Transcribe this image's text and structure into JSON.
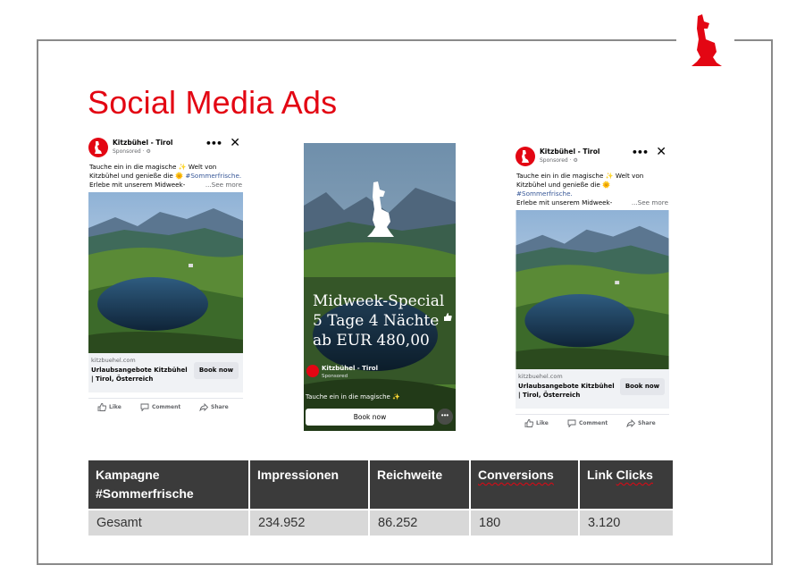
{
  "slide": {
    "title": "Social Media Ads",
    "accent_color": "#e30613",
    "logo_icon": "chamois-logo-icon"
  },
  "ad_feed": {
    "page_name": "Kitzbühel - Tirol",
    "sponsored": "Sponsored · ⚙",
    "text_line1": "Tauche ein in die magische ✨ Welt von",
    "text_line2a": "Kitzbühel und genieße die 🌞 ",
    "text_hashtag": "#Sommerfrische.",
    "text_line3": "Erlebe mit unserem Midweek-",
    "see_more": "...See more",
    "domain": "kitzbuehel.com",
    "headline": "Urlaubsangebote Kitzbühel | Tirol, Österreich",
    "cta": "Book now",
    "like": "Like",
    "comment": "Comment",
    "share": "Share",
    "more_icon": "more-dots-icon",
    "close_icon": "close-icon"
  },
  "ad_story": {
    "headline_line1": "Midweek-Special",
    "headline_line2": "5 Tage 4 Nächte",
    "headline_line3": "ab EUR 480,00",
    "page_name": "Kitzbühel - Tirol",
    "sponsored": "Sponsored",
    "text": "Tauche ein in die magische ✨",
    "cta": "Book now",
    "more": "•••"
  },
  "kpi_table": {
    "headers": [
      "Kampagne #Sommerfrische",
      "Impressionen",
      "Reichweite",
      "Conversions",
      "Link Clicks"
    ],
    "header_line1": "Kampagne",
    "header_line2": "#Sommerfrische",
    "header_link_word1": "Link",
    "header_link_word2": "Clicks",
    "row": [
      "Gesamt",
      "234.952",
      "86.252",
      "180",
      "3.120"
    ]
  }
}
